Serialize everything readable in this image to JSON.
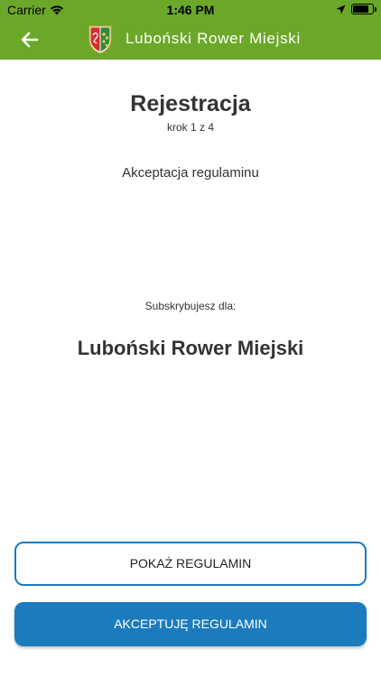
{
  "status_bar": {
    "carrier": "Carrier",
    "time": "1:46 PM",
    "icons": [
      "wifi-icon",
      "location-arrow-icon",
      "battery-icon"
    ],
    "battery_level": 0.8
  },
  "nav": {
    "title": "Luboński Rower Miejski",
    "back_icon": "arrow-left-icon",
    "logo": "city-coat-of-arms-logo"
  },
  "main": {
    "title": "Rejestracja",
    "step": "krok 1 z 4",
    "section": "Akceptacja regulaminu",
    "subscribe_label": "Subskrybujesz dla:",
    "system_name": "Luboński Rower Miejski"
  },
  "buttons": {
    "show_terms": "POKAŻ REGULAMIN",
    "accept_terms": "AKCEPTUJĘ REGULAMIN"
  },
  "colors": {
    "nav_bg": "#6ba82a",
    "primary": "#1b7bbd",
    "text": "#333333"
  }
}
